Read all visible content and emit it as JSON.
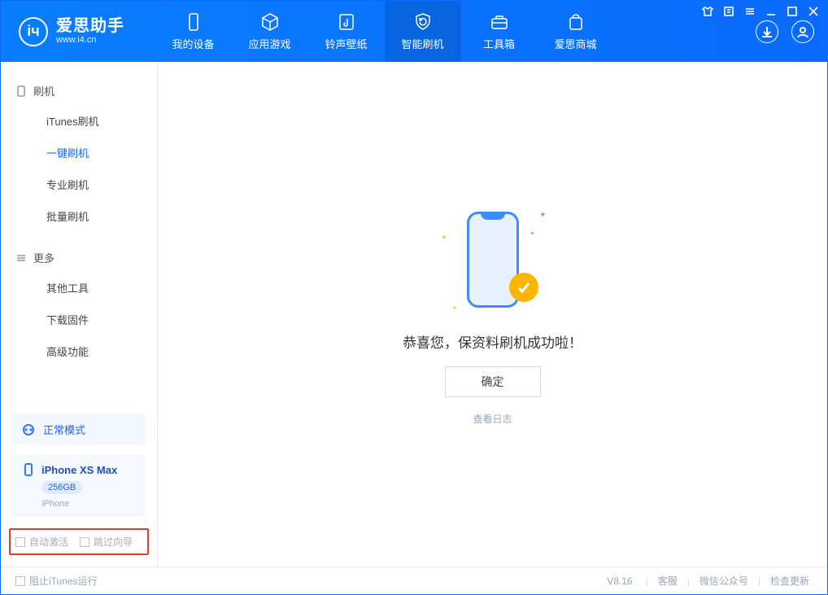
{
  "app": {
    "title": "爱思助手",
    "subtitle": "www.i4.cn"
  },
  "topnav": [
    {
      "label": "我的设备",
      "icon": "phone-icon"
    },
    {
      "label": "应用游戏",
      "icon": "cube-icon"
    },
    {
      "label": "铃声壁纸",
      "icon": "music-icon"
    },
    {
      "label": "智能刷机",
      "icon": "refresh-shield-icon",
      "active": true
    },
    {
      "label": "工具箱",
      "icon": "toolbox-icon"
    },
    {
      "label": "爱思商城",
      "icon": "store-icon"
    }
  ],
  "sidebar": {
    "section1": {
      "title": "刷机",
      "icon": "device-icon"
    },
    "items1": [
      {
        "label": "iTunes刷机"
      },
      {
        "label": "一键刷机",
        "active": true
      },
      {
        "label": "专业刷机"
      },
      {
        "label": "批量刷机"
      }
    ],
    "section2": {
      "title": "更多",
      "icon": "menu-icon"
    },
    "items2": [
      {
        "label": "其他工具"
      },
      {
        "label": "下载固件"
      },
      {
        "label": "高级功能"
      }
    ],
    "mode": {
      "label": "正常模式",
      "icon": "mode-icon"
    },
    "device": {
      "name": "iPhone XS Max",
      "capacity": "256GB",
      "type": "iPhone",
      "icon": "phone-small-icon"
    },
    "checks": {
      "auto_activate": "自动激活",
      "skip_wizard": "跳过向导"
    }
  },
  "main": {
    "success_text": "恭喜您，保资料刷机成功啦！",
    "ok_button": "确定",
    "view_log": "查看日志"
  },
  "footer": {
    "block_itunes": "阻止iTunes运行",
    "version": "V8.16",
    "links": {
      "support": "客服",
      "wechat": "微信公众号",
      "update": "检查更新"
    }
  }
}
